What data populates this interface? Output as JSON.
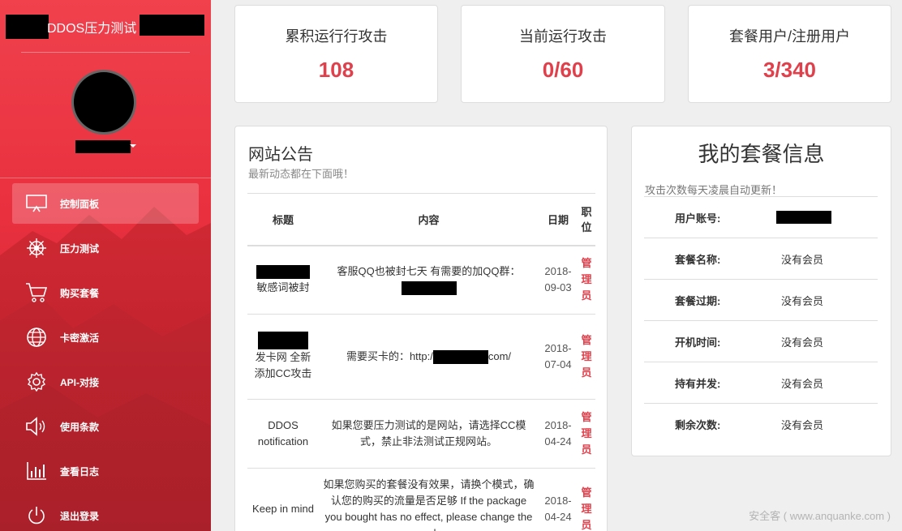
{
  "sidebar": {
    "brand": "DDOS压力测试",
    "items": [
      {
        "label": "控制面板",
        "icon": "monitor-icon",
        "active": true
      },
      {
        "label": "压力测试",
        "icon": "ship-wheel-icon",
        "active": false
      },
      {
        "label": "购买套餐",
        "icon": "shopping-cart-icon",
        "active": false
      },
      {
        "label": "卡密激活",
        "icon": "globe-icon",
        "active": false
      },
      {
        "label": "API-对接",
        "icon": "gear-icon",
        "active": false
      },
      {
        "label": "使用条款",
        "icon": "speaker-icon",
        "active": false
      },
      {
        "label": "查看日志",
        "icon": "bar-chart-icon",
        "active": false
      },
      {
        "label": "退出登录",
        "icon": "power-icon",
        "active": false
      }
    ]
  },
  "stats": [
    {
      "title": "累积运行行攻击",
      "value": "108"
    },
    {
      "title": "当前运行攻击",
      "value": "0/60"
    },
    {
      "title": "套餐用户/注册用户",
      "value": "3/340"
    }
  ],
  "announcements": {
    "title": "网站公告",
    "subtitle": "最新动态都在下面哦！",
    "headers": {
      "title": "标题",
      "content": "内容",
      "date": "日期",
      "role": "职位"
    },
    "rows": [
      {
        "title": "敏感词被封",
        "content_prefix": "客服QQ也被封七天 有需要的加QQ群：",
        "date": "2018-09-03",
        "role": "管理员"
      },
      {
        "title": "发卡网 全新添加CC攻击",
        "content_prefix": "需要买卡的：http:/",
        "content_suffix": "com/",
        "date": "2018-07-04",
        "role": "管理员"
      },
      {
        "title": "DDOS notification",
        "content_prefix": "如果您要压力测试的是网站，请选择CC模式，禁止非法测试正规网站。",
        "date": "2018-04-24",
        "role": "管理员"
      },
      {
        "title": "Keep in mind",
        "content_prefix": "如果您购买的套餐没有效果，请换个模式，确认您的购买的流量是否足够 If the package you bought has no effect, please change the mode",
        "date": "2018-04-24",
        "role": "管理员"
      }
    ]
  },
  "package": {
    "title": "我的套餐信息",
    "note": "攻击次数每天凌晨自动更新！",
    "rows": [
      {
        "key": "用户账号:",
        "value": ""
      },
      {
        "key": "套餐名称:",
        "value": "没有会员"
      },
      {
        "key": "套餐过期:",
        "value": "没有会员"
      },
      {
        "key": "开机时间:",
        "value": "没有会员"
      },
      {
        "key": "持有并发:",
        "value": "没有会员"
      },
      {
        "key": "剩余次数:",
        "value": "没有会员"
      }
    ]
  },
  "watermark": "安全客 ( www.anquanke.com )",
  "colors": {
    "accent": "#e0404b",
    "sidebar": "#e9303f"
  }
}
